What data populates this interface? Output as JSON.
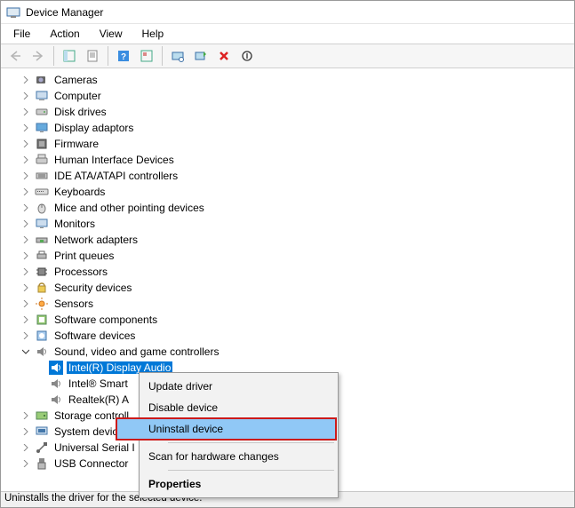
{
  "title": "Device Manager",
  "menu": {
    "file": "File",
    "action": "Action",
    "view": "View",
    "help": "Help"
  },
  "tree": {
    "cameras": "Cameras",
    "computer": "Computer",
    "diskdrives": "Disk drives",
    "displayadaptors": "Display adaptors",
    "firmware": "Firmware",
    "hid": "Human Interface Devices",
    "ide": "IDE ATA/ATAPI controllers",
    "keyboards": "Keyboards",
    "mice": "Mice and other pointing devices",
    "monitors": "Monitors",
    "network": "Network adapters",
    "printqueues": "Print queues",
    "processors": "Processors",
    "security": "Security devices",
    "sensors": "Sensors",
    "softcomp": "Software components",
    "softdev": "Software devices",
    "sound": "Sound, video and game controllers",
    "intel_display_audio": "Intel(R) Display Audio",
    "intel_smart": "Intel® Smart",
    "realtek": "Realtek(R) A",
    "storage": "Storage controll",
    "system": "System devices",
    "usb_serial": "Universal Serial I",
    "usb_connector": "USB Connector"
  },
  "context": {
    "update": "Update driver",
    "disable": "Disable device",
    "uninstall": "Uninstall device",
    "scan": "Scan for hardware changes",
    "properties": "Properties"
  },
  "status": "Uninstalls the driver for the selected device."
}
